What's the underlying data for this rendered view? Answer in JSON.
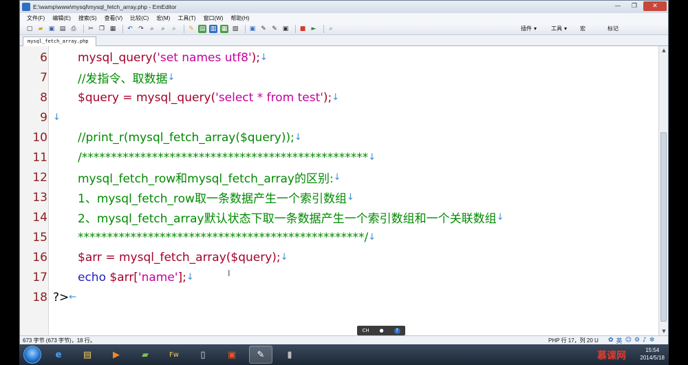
{
  "window": {
    "title": "E:\\wamp\\www\\mysql\\mysql_fetch_array.php - EmEditor",
    "controls": {
      "minimize": "—",
      "maximize": "❐",
      "close": "✕"
    }
  },
  "menu": [
    "文件(F)",
    "编辑(E)",
    "搜索(S)",
    "查看(V)",
    "比较(C)",
    "宏(M)",
    "工具(T)",
    "窗口(W)",
    "帮助(H)"
  ],
  "toolbar_right": {
    "plugins": "插件",
    "tools": "工具",
    "macro": "宏",
    "bookmarks": "标记"
  },
  "tab": {
    "label": "mysql_fetch_array.php"
  },
  "lines": [
    {
      "n": "6",
      "tokens": [
        {
          "t": "mysql_query(",
          "c": "red"
        },
        {
          "t": "'set names utf8'",
          "c": "str"
        },
        {
          "t": ");",
          "c": "red"
        },
        {
          "t": "↓",
          "c": "arrow"
        }
      ]
    },
    {
      "n": "7",
      "tokens": [
        {
          "t": "//发指令、取数据",
          "c": "cmt"
        },
        {
          "t": "↓",
          "c": "arrow"
        }
      ]
    },
    {
      "n": "8",
      "tokens": [
        {
          "t": "$query = mysql_query(",
          "c": "red"
        },
        {
          "t": "'select * from test'",
          "c": "str"
        },
        {
          "t": ");",
          "c": "red"
        },
        {
          "t": "↓",
          "c": "arrow"
        }
      ]
    },
    {
      "n": "9",
      "tokens": [
        {
          "t": "↓",
          "c": "arrow"
        }
      ],
      "indent": false
    },
    {
      "n": "10",
      "tokens": [
        {
          "t": "//print_r(mysql_fetch_array($query));",
          "c": "cmt"
        },
        {
          "t": "↓",
          "c": "arrow"
        }
      ]
    },
    {
      "n": "11",
      "tokens": [
        {
          "t": "/*************************************************",
          "c": "cmt"
        },
        {
          "t": "↓",
          "c": "arrow"
        }
      ]
    },
    {
      "n": "12",
      "tokens": [
        {
          "t": "mysql_fetch_row和mysql_fetch_array的区别:",
          "c": "cmt"
        },
        {
          "t": "↓",
          "c": "arrow"
        }
      ]
    },
    {
      "n": "13",
      "tokens": [
        {
          "t": "1、mysql_fetch_row取一条数据产生一个索引数组",
          "c": "cmt"
        },
        {
          "t": "↓",
          "c": "arrow"
        }
      ]
    },
    {
      "n": "14",
      "tokens": [
        {
          "t": "2、mysql_fetch_array默认状态下取一条数据产生一个索引数组和一个关联数组",
          "c": "cmt"
        },
        {
          "t": "↓",
          "c": "arrow"
        }
      ]
    },
    {
      "n": "15",
      "tokens": [
        {
          "t": "*************************************************/",
          "c": "cmt"
        },
        {
          "t": "↓",
          "c": "arrow"
        }
      ]
    },
    {
      "n": "16",
      "tokens": [
        {
          "t": "$arr = mysql_fetch_array($query);",
          "c": "red"
        },
        {
          "t": "↓",
          "c": "arrow"
        }
      ]
    },
    {
      "n": "17",
      "tokens": [
        {
          "t": "echo ",
          "c": "kw"
        },
        {
          "t": "$arr[",
          "c": "red"
        },
        {
          "t": "'name'",
          "c": "str"
        },
        {
          "t": "];",
          "c": "red"
        },
        {
          "t": "↓",
          "c": "arrow"
        }
      ]
    },
    {
      "n": "18",
      "tokens": [
        {
          "t": "?>",
          "c": "php"
        },
        {
          "t": "←",
          "c": "arrow"
        }
      ],
      "indent": false
    }
  ],
  "status": {
    "left": "673 字节 (673 字节)，18 行。",
    "right": "PHP  行 17，列 20  U"
  },
  "ime": {
    "label": "CH"
  },
  "tray": {
    "lang": "英"
  },
  "clock": {
    "time": "15:54",
    "date": "2014/5/18"
  },
  "taskbar": {
    "watermark": "慕课网"
  },
  "colors": {
    "red": "#a3002b",
    "str": "#c5009b",
    "cmt": "#008a00",
    "kw": "#1f1fb8",
    "arrow": "#3a8bd6",
    "linenum": "#8b1e1e"
  }
}
